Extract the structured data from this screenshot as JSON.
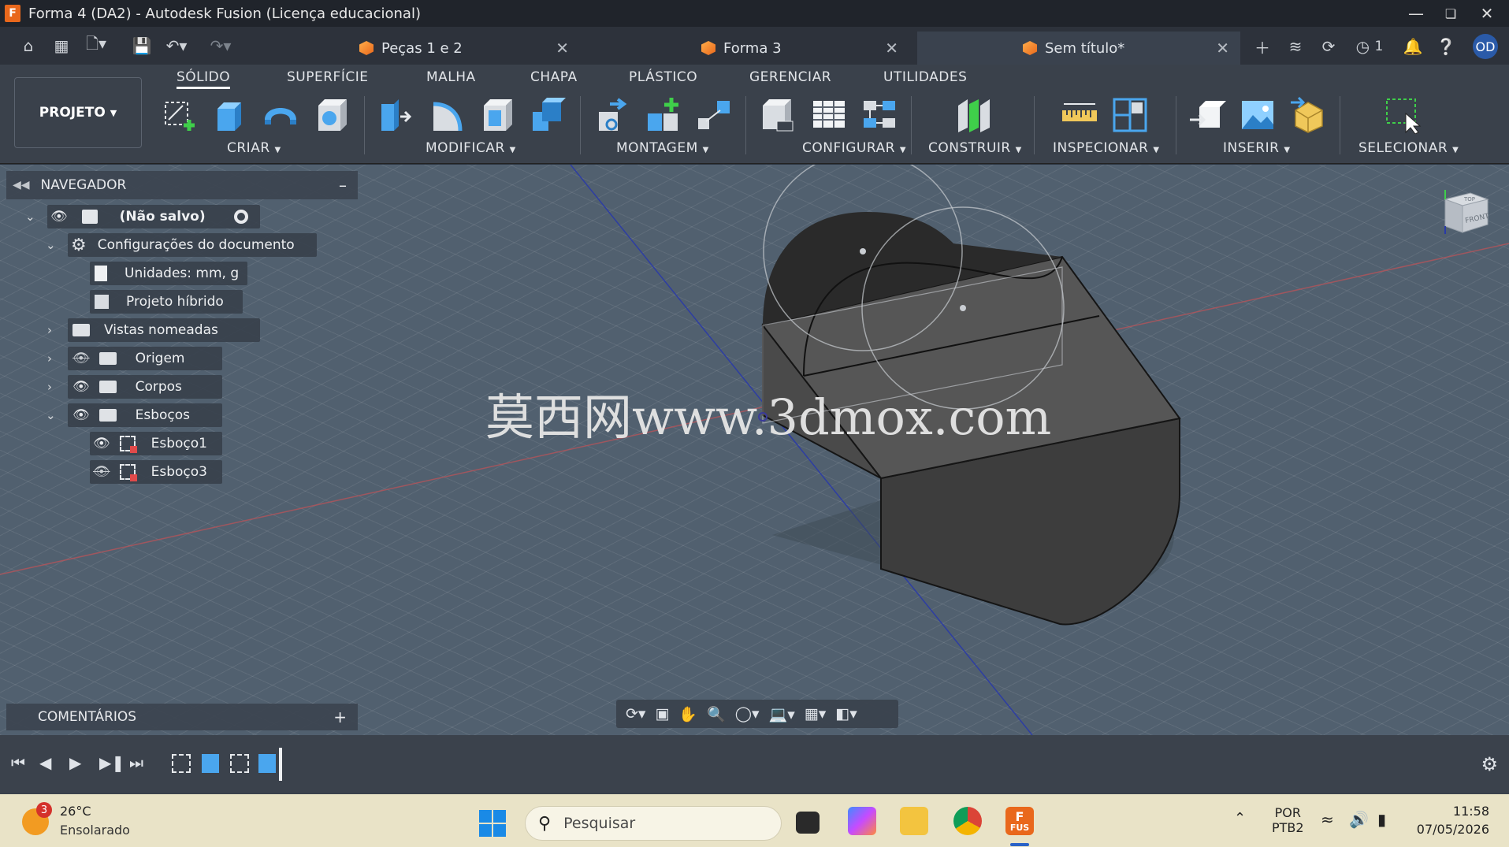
{
  "window": {
    "title": "Forma 4 (DA2) - Autodesk Fusion (Licença educacional)",
    "logo_letter": "F"
  },
  "tabs": [
    {
      "label": "Peças 1 e 2"
    },
    {
      "label": "Forma 3"
    },
    {
      "label": "Sem título*"
    }
  ],
  "header_right": {
    "jobs_count": "1",
    "avatar": "OD"
  },
  "ribbon": {
    "project_button": "PROJETO",
    "tabs": [
      "SÓLIDO",
      "SUPERFÍCIE",
      "MALHA",
      "CHAPA",
      "PLÁSTICO",
      "GERENCIAR",
      "UTILIDADES"
    ],
    "groups": [
      "CRIAR",
      "MODIFICAR",
      "MONTAGEM",
      "CONFIGURAR",
      "CONSTRUIR",
      "INSPECIONAR",
      "INSERIR",
      "SELECIONAR"
    ]
  },
  "browser": {
    "title": "NAVEGADOR",
    "items": [
      {
        "label": "(Não salvo)"
      },
      {
        "label": "Configurações do documento"
      },
      {
        "label": "Unidades: mm, g"
      },
      {
        "label": "Projeto híbrido"
      },
      {
        "label": "Vistas nomeadas"
      },
      {
        "label": "Origem"
      },
      {
        "label": "Corpos"
      },
      {
        "label": "Esboços"
      },
      {
        "label": "Esboço1"
      },
      {
        "label": "Esboço3"
      }
    ]
  },
  "watermark": "莫西网www.3dmox.com",
  "viewcube": {
    "top": "TOP",
    "front": "FRONT"
  },
  "comments": {
    "title": "COMENTÁRIOS"
  },
  "taskbar": {
    "weather_badge": "3",
    "temperature": "26°C",
    "weather": "Ensolarado",
    "search_placeholder": "Pesquisar",
    "fusion_label": "FUS",
    "lang": "POR",
    "layout": "PTB2",
    "time": "11:58",
    "date": "07/05/2026"
  },
  "colors": {
    "accent_orange": "#e9681c",
    "body_dark": "#3c3c3c",
    "avatar_blue": "#2a5aa8"
  }
}
